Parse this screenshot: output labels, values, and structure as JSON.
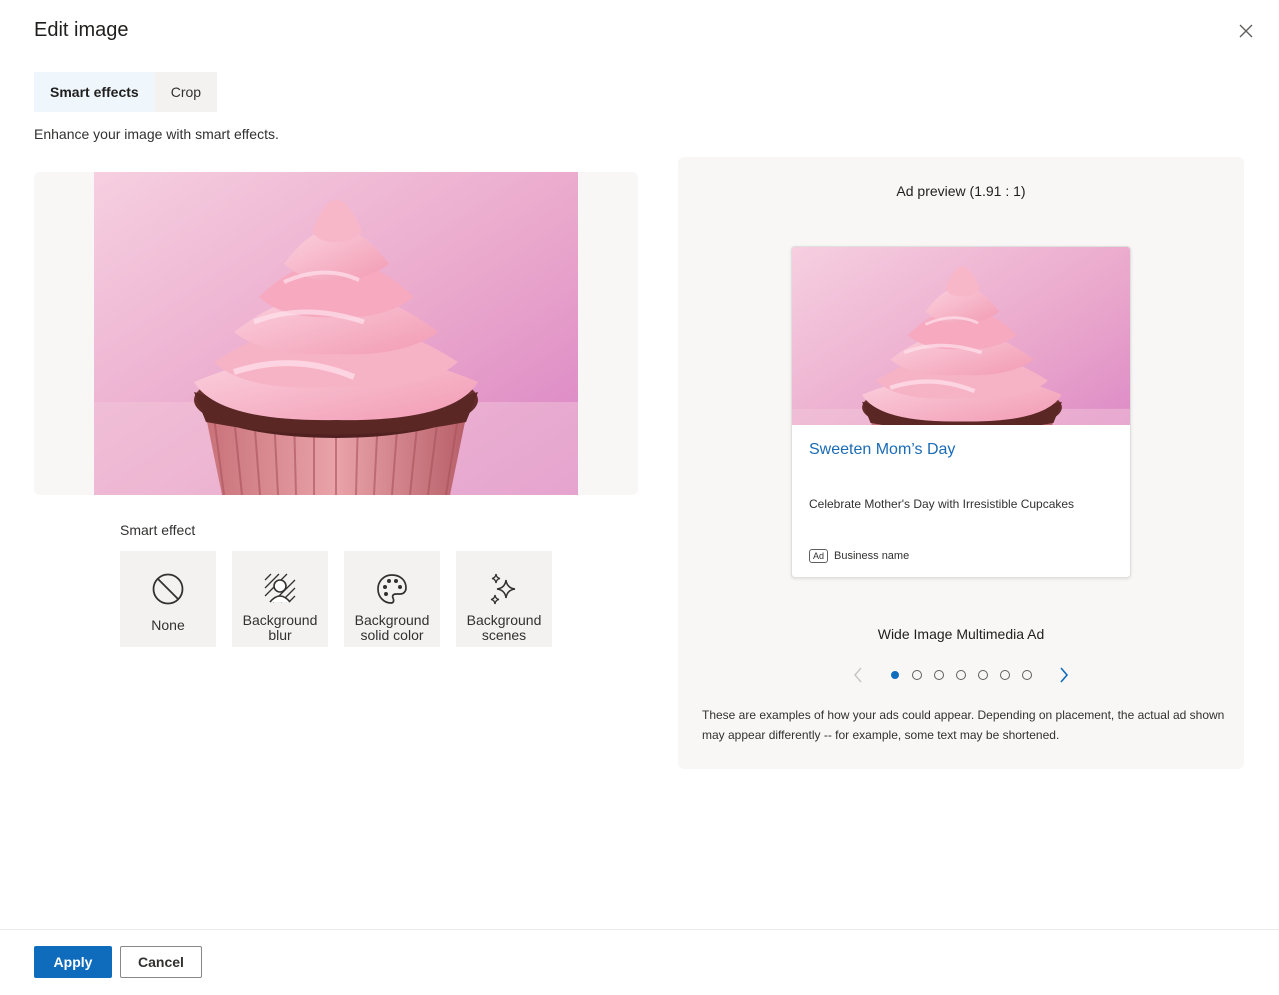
{
  "dialog": {
    "title": "Edit image",
    "close_icon": "close-icon"
  },
  "tabs": [
    {
      "label": "Smart effects",
      "selected": true
    },
    {
      "label": "Crop",
      "selected": false
    }
  ],
  "subtitle": "Enhance your image with smart effects.",
  "editor": {
    "image": "pink-frosted-cupcake"
  },
  "smart_effect": {
    "label": "Smart effect",
    "options": [
      {
        "label": "None",
        "icon": "prohibited-icon"
      },
      {
        "label": "Background blur",
        "line1": "Background",
        "line2": "blur",
        "icon": "background-blur-icon"
      },
      {
        "label": "Background solid color",
        "line1": "Background",
        "line2": "solid color",
        "icon": "palette-icon"
      },
      {
        "label": "Background scenes",
        "line1": "Background",
        "line2": "scenes",
        "icon": "sparkle-icon"
      }
    ]
  },
  "preview": {
    "title": "Ad preview (1.91 : 1)",
    "ad": {
      "headline": "Sweeten Mom’s Day",
      "description": "Celebrate Mother's Day with Irresistible Cupcakes",
      "badge": "Ad",
      "business": "Business name"
    },
    "format_label": "Wide Image Multimedia Ad",
    "carousel": {
      "page_count": 7,
      "current_page": 1
    },
    "disclaimer": "These are examples of how your ads could appear. Depending on placement, the actual ad shown may appear differently -- for example, some text may be shortened."
  },
  "footer": {
    "apply_label": "Apply",
    "cancel_label": "Cancel"
  },
  "colors": {
    "accent": "#0f6cbd",
    "headline_link": "#1b6bb5",
    "tab_selected_bg": "#eff6fc",
    "tile_bg": "#f3f2f1",
    "panel_bg": "#f8f7f6"
  }
}
